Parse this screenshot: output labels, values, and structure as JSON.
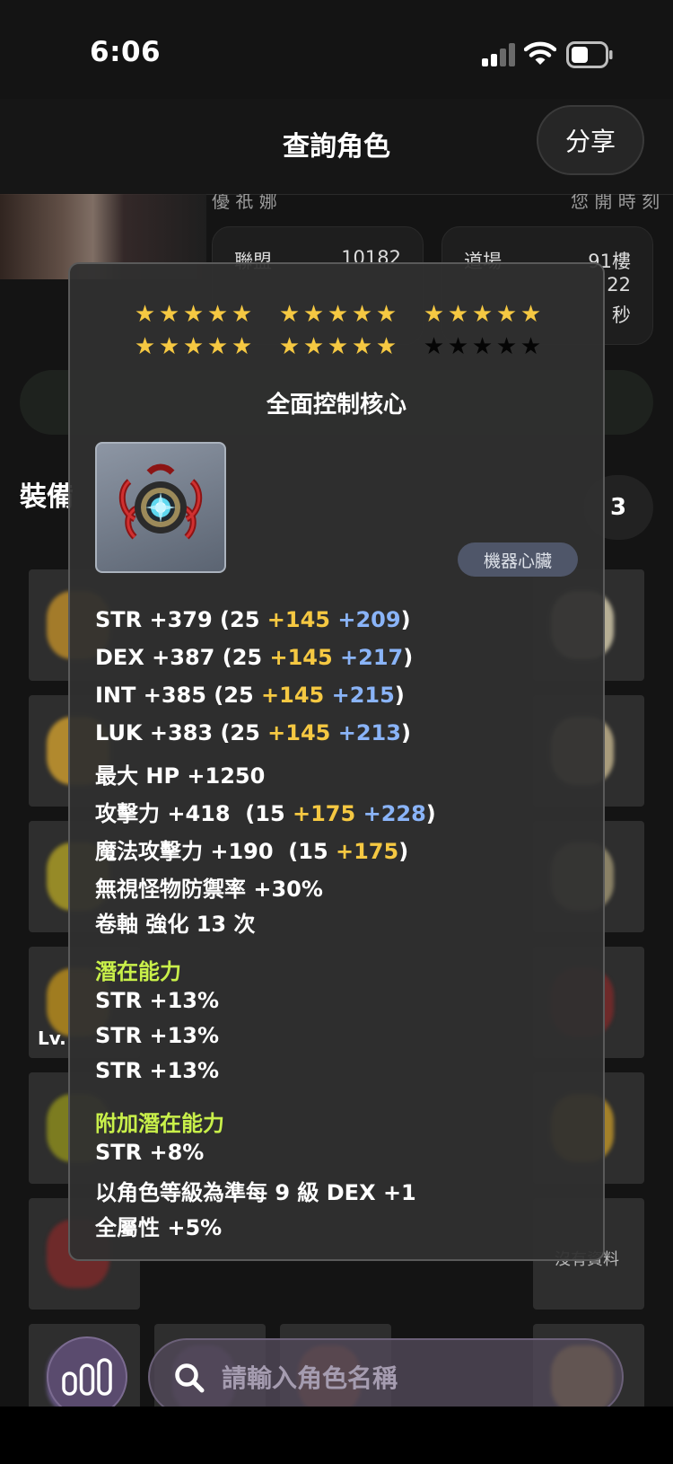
{
  "status_bar": {
    "time": "6:06"
  },
  "header": {
    "title": "查詢角色",
    "share_label": "分享"
  },
  "background": {
    "character_name": "優 祇 娜",
    "right_name": "您 開 時 刻",
    "card_left": {
      "label": "聯盟",
      "value": "10182"
    },
    "card_right": {
      "rows": [
        {
          "label": "道場",
          "value": "91樓"
        },
        {
          "label": "",
          "value": "22"
        },
        {
          "label": "",
          "value": "秒"
        }
      ]
    },
    "section_title": "裝備",
    "count": "3",
    "no_data": "沒有資料",
    "lv_label": "Lv."
  },
  "popup": {
    "stars": {
      "gold_count": 25,
      "dark_count": 5
    },
    "item_name": "全面控制核心",
    "item_type": "機器心臟",
    "stats": [
      {
        "label": "STR +379 (25 ",
        "gold": "+145",
        "blue": "+209",
        "tail": ")"
      },
      {
        "label": "DEX +387 (25 ",
        "gold": "+145",
        "blue": "+217",
        "tail": ")"
      },
      {
        "label": "INT +385 (25 ",
        "gold": "+145",
        "blue": "+215",
        "tail": ")"
      },
      {
        "label": "LUK +383 (25 ",
        "gold": "+145",
        "blue": "+213",
        "tail": ")"
      }
    ],
    "max_hp": "最大 HP +1250",
    "attack": {
      "label": "攻擊力 +418  (15 ",
      "gold": "+175",
      "blue": "+228",
      "tail": ")"
    },
    "magic_attack": {
      "label": "魔法攻擊力 +190  (15 ",
      "gold": "+175",
      "tail": ")"
    },
    "ignore_def": "無視怪物防禦率 +30%",
    "scroll": "卷軸 強化 13 次",
    "potential_title": "潛在能力",
    "potential": [
      "STR +13%",
      "STR +13%",
      "STR +13%"
    ],
    "bonus_potential_title": "附加潛在能力",
    "bonus_potential": [
      "STR +8%",
      "以角色等級為準每 9 級 DEX +1",
      "全屬性 +5%"
    ]
  },
  "search": {
    "placeholder": "請輸入角色名稱",
    "value": ""
  },
  "icons": {
    "menu": "bar-chart-icon",
    "search": "magnifier-icon",
    "signal": "cellular-signal-icon",
    "wifi": "wifi-icon",
    "battery": "battery-icon"
  },
  "colors": {
    "star_gold": "#f5c842",
    "bonus_gold": "#f5c842",
    "bonus_blue": "#8ab4f8",
    "potential_green": "#c9f04a",
    "popup_bg": "#303030"
  }
}
